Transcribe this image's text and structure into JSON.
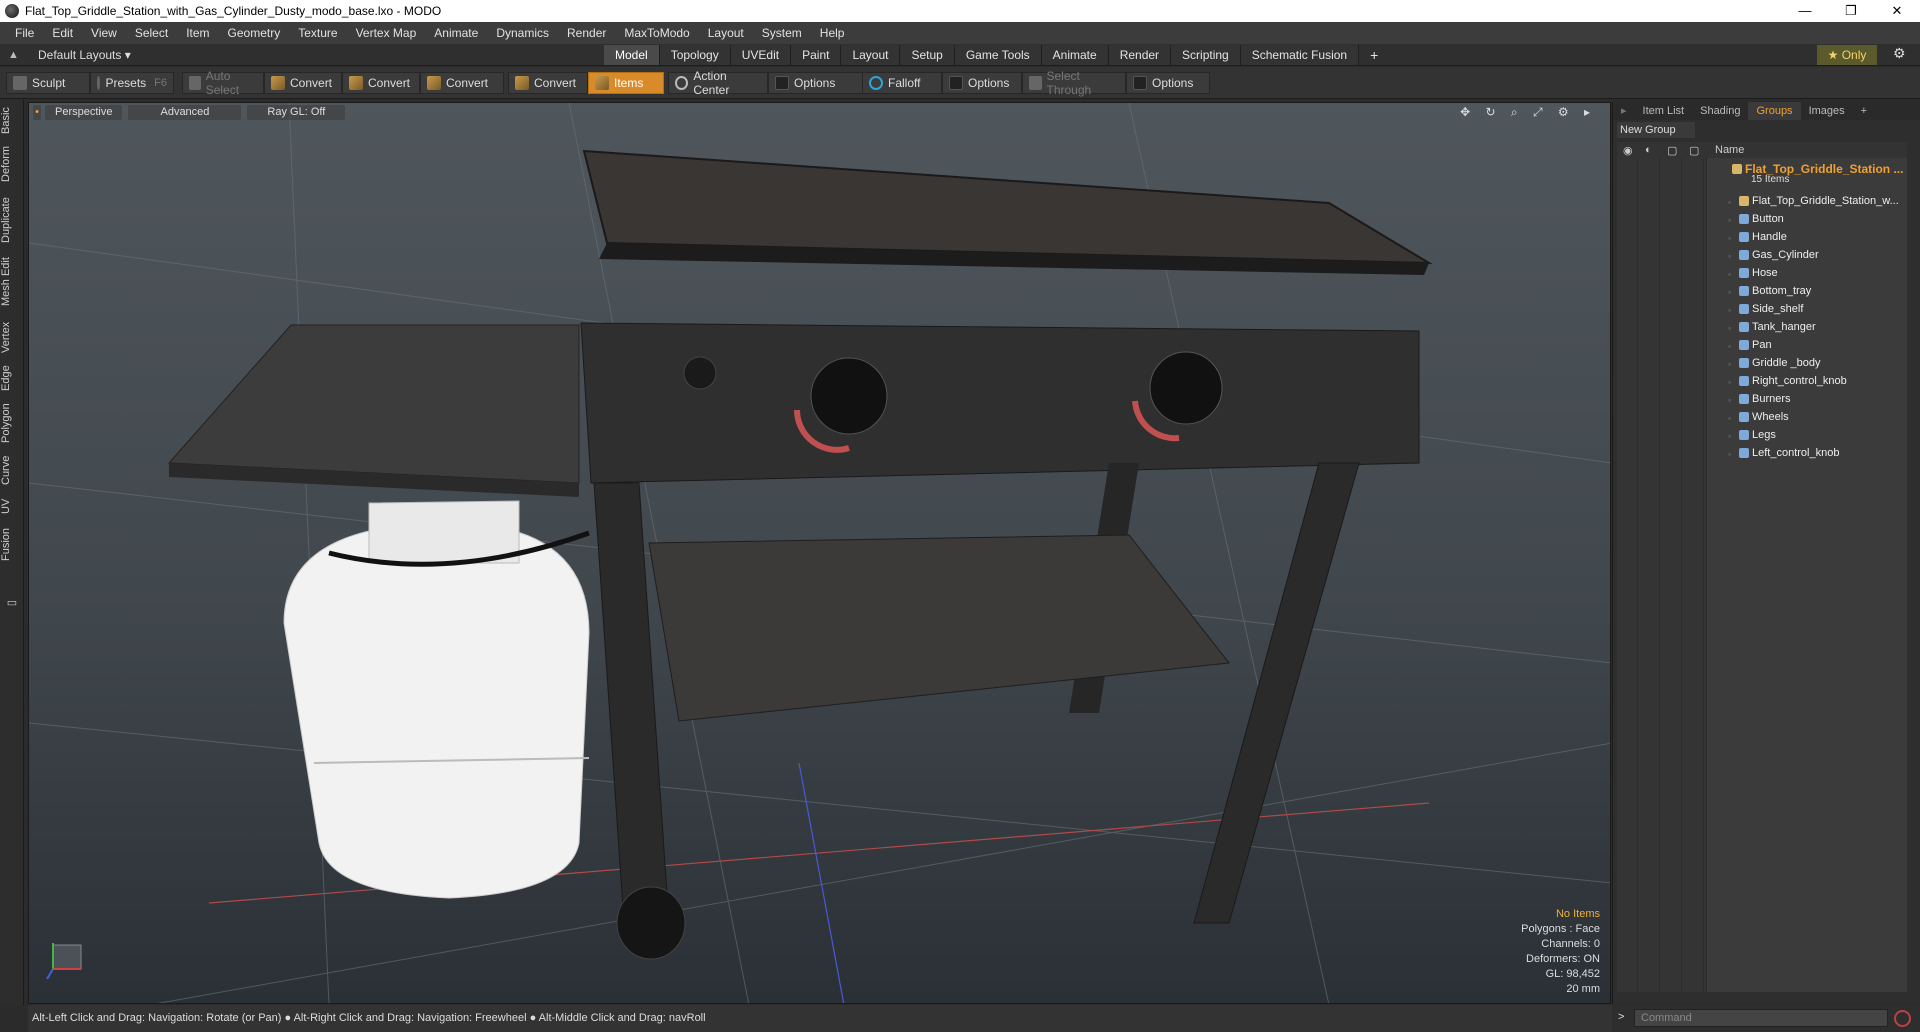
{
  "window": {
    "title": "Flat_Top_Griddle_Station_with_Gas_Cylinder_Dusty_modo_base.lxo - MODO",
    "minimize": "—",
    "restore": "❐",
    "close": "✕"
  },
  "menu": [
    "File",
    "Edit",
    "View",
    "Select",
    "Item",
    "Geometry",
    "Texture",
    "Vertex Map",
    "Animate",
    "Dynamics",
    "Render",
    "MaxToModo",
    "Layout",
    "System",
    "Help"
  ],
  "layoutbar": {
    "layouts_label": "Default Layouts ▾",
    "tabs": [
      "Model",
      "Topology",
      "UVEdit",
      "Paint",
      "Layout",
      "Setup",
      "Game Tools",
      "Animate",
      "Render",
      "Scripting",
      "Schematic Fusion"
    ],
    "active_tab": "Model",
    "plus": "+",
    "only_label": "★  Only",
    "gear": "⚙"
  },
  "toolbar": {
    "sculpt": "Sculpt",
    "presets": "Presets",
    "presets_key": "F6",
    "auto_select": "Auto Select",
    "convert1": "Convert",
    "convert2": "Convert",
    "convert3": "Convert",
    "convert4": "Convert",
    "items": "Items",
    "action_center": "Action Center",
    "options1": "Options",
    "falloff": "Falloff",
    "options2": "Options",
    "select_through": "Select Through",
    "options3": "Options"
  },
  "left_tabs": [
    "Basic",
    "Deform",
    "Duplicate",
    "Mesh Edit",
    "Vertex",
    "Edge",
    "Polygon",
    "Curve",
    "UV",
    "Fusion"
  ],
  "viewport": {
    "perspective": "Perspective",
    "advanced": "Advanced",
    "raygl": "Ray GL: Off",
    "icons": "✥ ↻ ⌕ ⤢ ⚙ ▸",
    "info": {
      "no_items": "No Items",
      "polygons": "Polygons : Face",
      "channels": "Channels: 0",
      "deformers": "Deformers: ON",
      "gl": "GL: 98,452",
      "scale": "20 mm"
    }
  },
  "right_panel": {
    "tabs": [
      "Item List",
      "Shading",
      "Groups",
      "Images",
      "+"
    ],
    "active_tab": "Groups",
    "new_group": "New Group",
    "name_header": "Name",
    "group_name": "Flat_Top_Griddle_Station ...",
    "group_count": "15 Items",
    "items": [
      "Flat_Top_Griddle_Station_w...",
      "Button",
      "Handle",
      "Gas_Cylinder",
      "Hose",
      "Bottom_tray",
      "Side_shelf",
      "Tank_hanger",
      "Pan",
      "Griddle _body",
      "Right_control_knob",
      "Burners",
      "Wheels",
      "Legs",
      "Left_control_knob"
    ]
  },
  "status": {
    "text": "Alt-Left Click and Drag: Navigation: Rotate (or Pan) ● Alt-Right Click and Drag: Navigation: Freewheel ● Alt-Middle Click and Drag: navRoll"
  },
  "command": {
    "prompt": ">",
    "placeholder": "Command"
  }
}
